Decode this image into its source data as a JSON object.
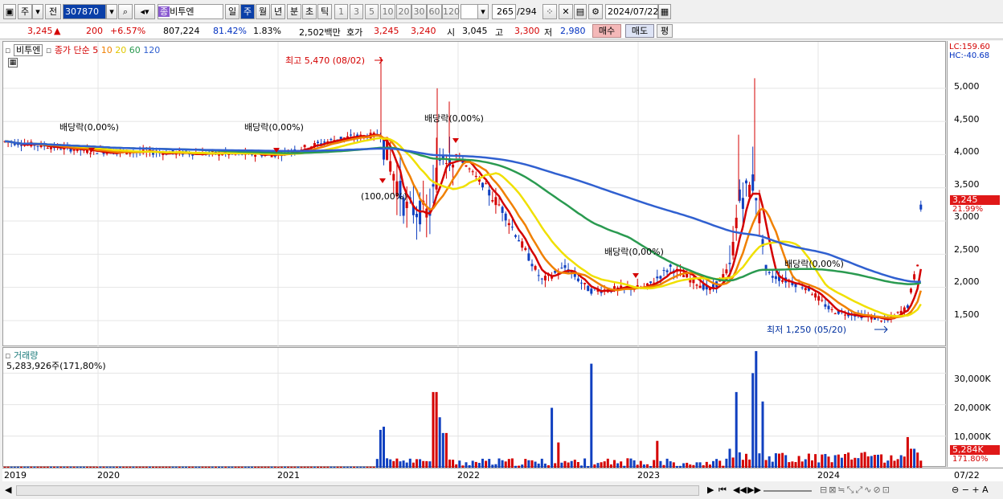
{
  "toolbar": {
    "type_label": "주",
    "prev_label": "전",
    "code": "307870",
    "stock_badge": "종",
    "stock_name": "비투엔",
    "periods": [
      "일",
      "주",
      "월",
      "년",
      "분",
      "초",
      "틱"
    ],
    "active_period": "주",
    "minutes": [
      "1",
      "3",
      "5",
      "10",
      "20",
      "30",
      "60",
      "120"
    ],
    "page_cur": "265",
    "page_total": "/294",
    "date": "2024/07/22"
  },
  "info": {
    "price": "3,245",
    "arrow": "▲",
    "change": "200",
    "change_pct": "+6.57%",
    "volume": "807,224",
    "vol_ratio": "81.42%",
    "turnover": "1.83%",
    "amount": "2,502백만",
    "hoga_label": "호가",
    "ask": "3,245",
    "bid": "3,240",
    "open_label": "시",
    "open": "3,045",
    "high_label": "고",
    "high": "3,300",
    "low_label": "저",
    "low": "2,980",
    "buy": "매수",
    "sell": "매도",
    "eval": "평"
  },
  "legend": {
    "name": "비투엔",
    "ma_label": "종가 단순",
    "ma": [
      "5",
      "10",
      "20",
      "60",
      "120"
    ]
  },
  "ma_colors": [
    "#d40000",
    "#f08000",
    "#f0e000",
    "#2a9a50",
    "#3060d0"
  ],
  "annotations": {
    "high": "최고 5,470 (08/02)",
    "low": "최저 1,250 (05/20)",
    "div1": "배당락(0,00%)",
    "div2": "배당락(0,00%)",
    "div3": "배당락(0,00%)",
    "div4": "배당락(0,00%)",
    "div5": "배당락(0,00%)",
    "split": "(100,00%)"
  },
  "right_axis": {
    "lc": "LC:159.60",
    "hc": "HC:-40.68",
    "ticks": [
      "5,000",
      "4,500",
      "4,000",
      "3,500",
      "3,000",
      "2,500",
      "2,000",
      "1,500"
    ],
    "price_tag": "3,245",
    "price_pct": "21.99%",
    "vol_ticks": [
      "30,000K",
      "20,000K",
      "10,000K"
    ],
    "vol_tag": "5,284K",
    "vol_pct": "171.80%"
  },
  "volume_panel": {
    "title": "거래량",
    "value": "5,283,926주(171,80%)"
  },
  "x_axis": [
    "2019",
    "2020",
    "2021",
    "2022",
    "2023",
    "2024"
  ],
  "x_axis_last": "07/22",
  "chart_data": {
    "type": "line",
    "x": [
      "2019",
      "2020",
      "2021",
      "2022",
      "2023",
      "2024",
      "07/22"
    ],
    "series": [
      {
        "values": [
          4200,
          4050,
          4000,
          4200,
          3200,
          2400,
          2000,
          1900,
          3300,
          2000,
          1600,
          3245
        ]
      }
    ],
    "ylim": [
      1100,
      5700
    ],
    "y_ticks": [
      1500,
      2000,
      2500,
      3000,
      3500,
      4000,
      4500,
      5000
    ],
    "volume_ticks": [
      "10,000K",
      "20,000K",
      "30,000K"
    ]
  }
}
